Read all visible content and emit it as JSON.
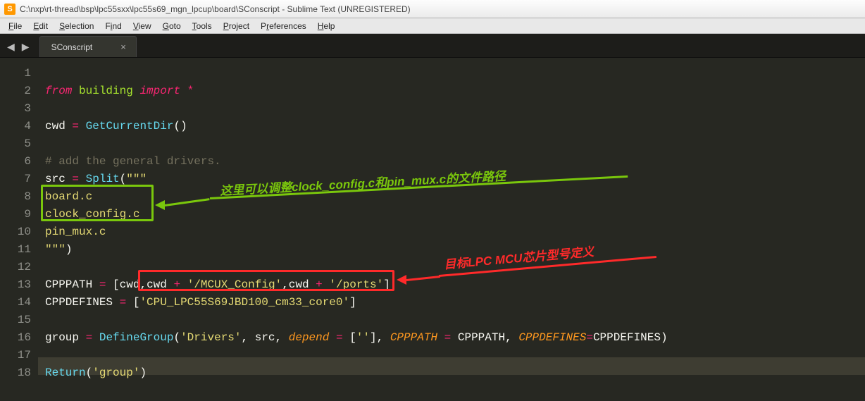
{
  "window": {
    "title": "C:\\nxp\\rt-thread\\bsp\\lpc55sxx\\lpc55s69_mgn_lpcup\\board\\SConscript - Sublime Text (UNREGISTERED)"
  },
  "menu": {
    "file": "File",
    "edit": "Edit",
    "selection": "Selection",
    "find": "Find",
    "view": "View",
    "goto": "Goto",
    "tools": "Tools",
    "project": "Project",
    "preferences": "Preferences",
    "help": "Help"
  },
  "tab": {
    "name": "SConscript",
    "close": "×"
  },
  "nav": {
    "back": "◀",
    "fwd": "▶"
  },
  "gutter": [
    "1",
    "2",
    "3",
    "4",
    "5",
    "6",
    "7",
    "8",
    "9",
    "10",
    "11",
    "12",
    "13",
    "14",
    "15",
    "16",
    "17",
    "18"
  ],
  "code": {
    "l1_from": "from",
    "l1_mod": "building",
    "l1_import": "import",
    "l1_star": "*",
    "l3_cwd": "cwd",
    "l3_eq": "=",
    "l3_fn": "GetCurrentDir",
    "l3_paren": "()",
    "l5_cmt": "# add the general drivers.",
    "l6_src": "src",
    "l6_eq": "=",
    "l6_fn": "Split",
    "l6_open": "(",
    "l6_str_open": "\"\"\"",
    "l7": "board.c",
    "l8": "clock_config.c",
    "l9": "pin_mux.c",
    "l10_str_close": "\"\"\"",
    "l10_close": ")",
    "l12_var": "CPPPATH",
    "l12_eq": "=",
    "l12_open": "[",
    "l12_cwd1": "cwd",
    "l12_c1": ",",
    "l12_cwd2": "cwd",
    "l12_plus1": "+",
    "l12_s1": "'/MCUX_Config'",
    "l12_c2": ",",
    "l12_cwd3": "cwd",
    "l12_plus2": "+",
    "l12_s2": "'/ports'",
    "l12_close": "]",
    "l13_var": "CPPDEFINES",
    "l13_eq": "=",
    "l13_open": "[",
    "l13_s": "'CPU_LPC55S69JBD100_cm33_core0'",
    "l13_close": "]",
    "l15_var": "group",
    "l15_eq": "=",
    "l15_fn": "DefineGroup",
    "l15_open": "(",
    "l15_s1": "'Drivers'",
    "l15_c1": ",",
    "l15_src": "src",
    "l15_c2": ",",
    "l15_arg1": "depend",
    "l15_eq2": "=",
    "l15_dep": "['']",
    "l15_c3": ",",
    "l15_arg2": "CPPPATH",
    "l15_eq3": "=",
    "l15_v2": "CPPPATH",
    "l15_c4": ",",
    "l15_arg3": "CPPDEFINES",
    "l15_eq4": "=",
    "l15_v3": "CPPDEFINES",
    "l15_close": ")",
    "l17_fn": "Return",
    "l17_open": "(",
    "l17_s": "'group'",
    "l17_close": ")"
  },
  "annotations": {
    "green_pre": "这里可以调整",
    "green_b1": "clock_config.c",
    "green_mid": "和",
    "green_b2": "pin_mux.c",
    "green_post": "的文件路径",
    "red_pre": "目标",
    "red_b1": "LPC MCU",
    "red_post": "芯片型号定义"
  }
}
